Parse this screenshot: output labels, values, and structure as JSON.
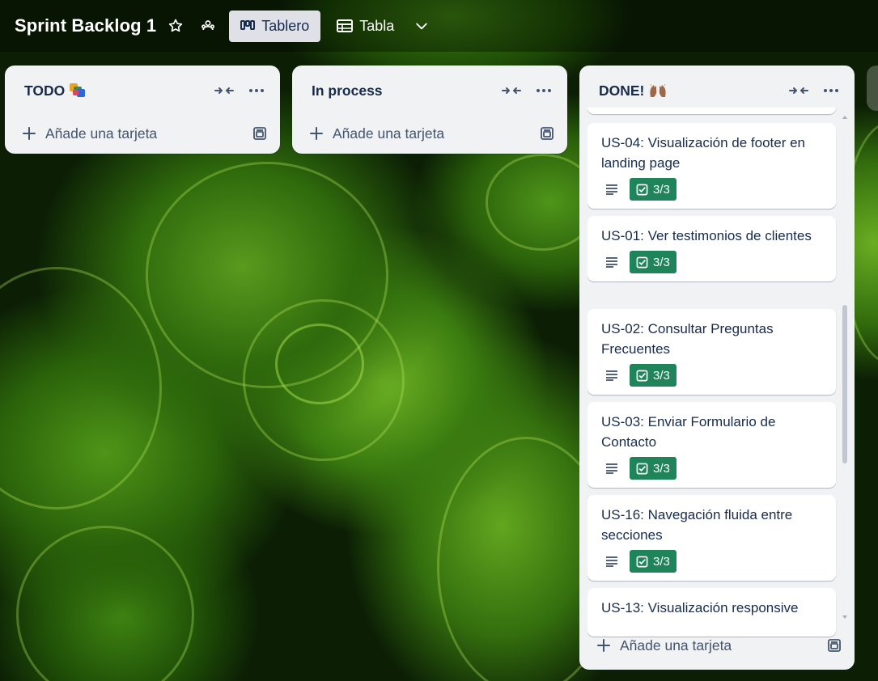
{
  "board": {
    "title": "Sprint Backlog 1",
    "star_icon": "star-icon",
    "visibility_icon": "workspace-visibility-icon"
  },
  "views": {
    "board_label": "Tablero",
    "table_label": "Tabla"
  },
  "lists": [
    {
      "title": "TODO",
      "add_card_label": "Añade una tarjeta",
      "cards": []
    },
    {
      "title": "In process",
      "add_card_label": "Añade una tarjeta",
      "cards": []
    },
    {
      "title": "DONE!",
      "add_card_label": "Añade una tarjeta",
      "cards": [
        {
          "title": "US-04: Visualización de footer en landing page",
          "checklist": "3/3"
        },
        {
          "title": "US-01: Ver testimonios de clientes",
          "checklist": "3/3"
        },
        {
          "title": "US-02: Consultar Preguntas Frecuentes",
          "checklist": "3/3"
        },
        {
          "title": "US-03: Enviar Formulario de Contacto",
          "checklist": "3/3"
        },
        {
          "title": "US-16: Navegación fluida entre secciones",
          "checklist": "3/3"
        },
        {
          "title": "US-13: Visualización responsive"
        }
      ]
    }
  ],
  "colors": {
    "list_bg": "#f1f2f4",
    "checklist_complete": "#1f845a",
    "text_primary": "#172b4d",
    "text_subtle": "#44546f"
  }
}
